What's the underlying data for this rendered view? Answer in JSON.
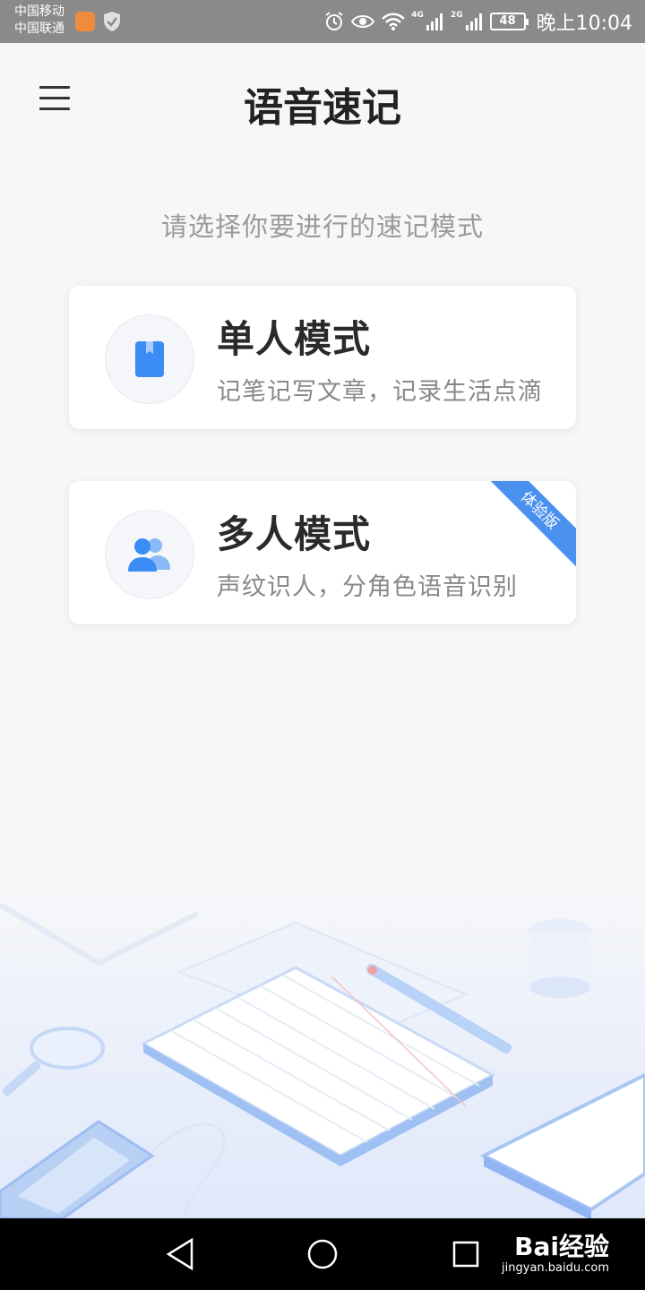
{
  "status_bar": {
    "carrier_1": "中国移动",
    "carrier_2": "中国联通",
    "network_1": "4G",
    "network_2": "2G",
    "battery": "48",
    "time": "晚上10:04"
  },
  "header": {
    "title": "语音速记",
    "menu_icon": "menu-icon"
  },
  "prompt": "请选择你要进行的速记模式",
  "modes": [
    {
      "title": "单人模式",
      "desc": "记笔记写文章，记录生活点滴",
      "icon": "notebook-icon"
    },
    {
      "title": "多人模式",
      "desc": "声纹识人，分角色语音识别",
      "icon": "users-icon",
      "badge": "体验版"
    }
  ],
  "nav": {
    "watermark": "Bai经验",
    "watermark_url": "jingyan.baidu.com"
  },
  "colors": {
    "accent": "#4a90ee",
    "icon_blue": "#3b8cf5"
  }
}
